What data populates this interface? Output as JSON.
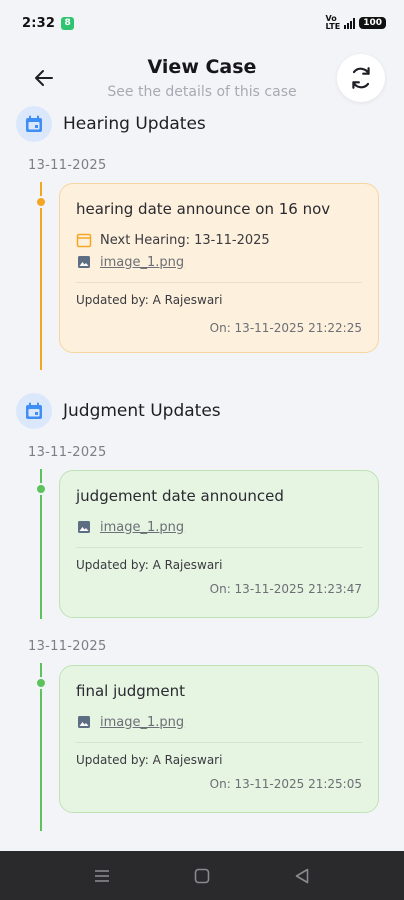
{
  "status_bar": {
    "time": "2:32",
    "app_badge": "8",
    "network_label_top": "Vo",
    "network_label_bottom": "LTE",
    "battery": "100"
  },
  "header": {
    "title": "View Case",
    "subtitle": "See the details of this case"
  },
  "sections": {
    "hearing": {
      "title": "Hearing Updates",
      "entries": [
        {
          "date": "13-11-2025",
          "text": "hearing date announce on 16 nov",
          "next_hearing": "Next Hearing: 13-11-2025",
          "attachment": "image_1.png",
          "updated_by": "Updated by: A Rajeswari",
          "updated_on": "On: 13-11-2025 21:22:25"
        }
      ]
    },
    "judgment": {
      "title": "Judgment Updates",
      "entries": [
        {
          "date": "13-11-2025",
          "text": "judgement date announced",
          "attachment": "image_1.png",
          "updated_by": "Updated by: A Rajeswari",
          "updated_on": "On: 13-11-2025 21:23:47"
        },
        {
          "date": "13-11-2025",
          "text": "final judgment",
          "attachment": "image_1.png",
          "updated_by": "Updated by: A Rajeswari",
          "updated_on": "On: 13-11-2025 21:25:05"
        }
      ]
    }
  },
  "colors": {
    "hearing_accent": "#f5a524",
    "judgment_accent": "#5cc35c",
    "section_icon_blue": "#3f8ef5"
  },
  "icons": {
    "back": "arrow-left-icon",
    "refresh": "refresh-icon",
    "section": "calendar-icon",
    "next_hearing": "calendar-icon",
    "attachment": "image-icon"
  }
}
